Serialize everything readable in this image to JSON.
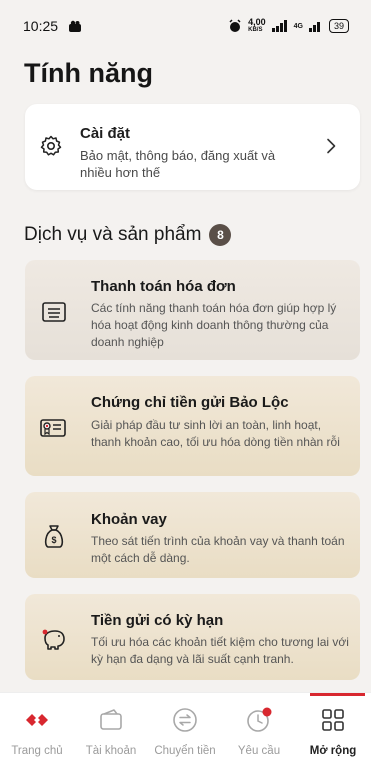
{
  "status_bar": {
    "time": "10:25",
    "speed": "4,00",
    "speed_unit": "KB/S",
    "network": "4G",
    "battery": "39"
  },
  "page": {
    "title": "Tính năng"
  },
  "settings": {
    "title": "Cài đặt",
    "description": "Bảo mật, thông báo, đăng xuất và nhiều hơn thế",
    "icon": "gear-icon"
  },
  "section": {
    "title": "Dịch vụ và sản phẩm",
    "count": "8"
  },
  "products": [
    {
      "title": "Thanh toán hóa đơn",
      "description": "Các tính năng thanh toán hóa đơn giúp hợp lý hóa hoạt động kinh doanh thông thường của doanh nghiệp",
      "icon": "bill-icon"
    },
    {
      "title": "Chứng chỉ tiền gửi Bảo Lộc",
      "description": "Giải pháp đầu tư sinh lời an toàn, linh hoạt, thanh khoản cao, tối ưu hóa dòng tiền nhàn rỗi",
      "icon": "certificate-icon"
    },
    {
      "title": "Khoản vay",
      "description": "Theo sát tiến trình của khoản vay và thanh toán một cách dễ dàng.",
      "icon": "money-bag-icon"
    },
    {
      "title": "Tiền gửi có kỳ hạn",
      "description": "Tối ưu hóa các khoản tiết kiệm cho tương lai với kỳ hạn đa dạng và lãi suất cạnh tranh.",
      "icon": "piggy-bank-icon"
    }
  ],
  "nav": {
    "items": [
      {
        "label": "Trang chủ",
        "icon": "home-logo-icon"
      },
      {
        "label": "Tài khoản",
        "icon": "wallet-icon"
      },
      {
        "label": "Chuyển tiền",
        "icon": "transfer-icon"
      },
      {
        "label": "Yêu cầu",
        "icon": "history-icon"
      },
      {
        "label": "Mở rộng",
        "icon": "grid-icon"
      }
    ],
    "active": "Mở rộng"
  },
  "colors": {
    "brand_red": "#d8282f",
    "background": "#f4f2f0",
    "card_tan": "#ece2cf"
  }
}
